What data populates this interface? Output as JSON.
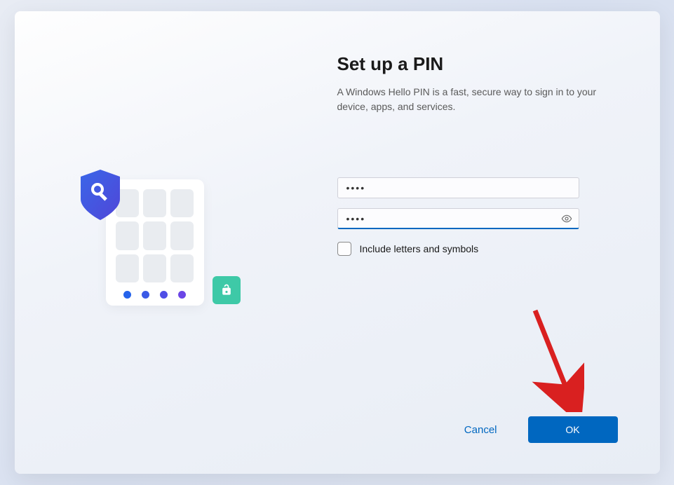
{
  "title": "Set up a PIN",
  "description": "A Windows Hello PIN is a fast, secure way to sign in to your device, apps, and services.",
  "inputs": {
    "pin_value": "••••",
    "confirm_pin_value": "••••"
  },
  "checkbox": {
    "label": "Include letters and symbols",
    "checked": false
  },
  "buttons": {
    "cancel": "Cancel",
    "ok": "OK"
  },
  "colors": {
    "primary": "#0067c0",
    "shield_start": "#3a66e8",
    "shield_end": "#5046d8",
    "unlock_badge": "#3ec9a7",
    "annotation": "#d92020"
  }
}
